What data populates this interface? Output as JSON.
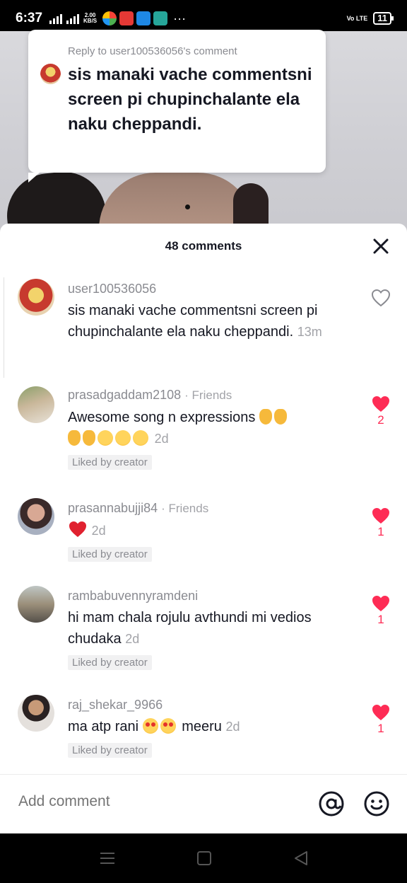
{
  "status_bar": {
    "time": "6:37",
    "net_speed_value": "2.00",
    "net_speed_unit": "KB/S",
    "carrier": "Vo LTE",
    "battery": "11"
  },
  "reply_sticker": {
    "header": "Reply to user100536056's comment",
    "text": "sis manaki vache commentsni screen pi chupinchalante ela naku cheppandi."
  },
  "comments_panel": {
    "count_label": "48 comments",
    "comments": [
      {
        "username": "user100536056",
        "friends": "",
        "text": "sis manaki vache commentsni screen pi chupinchalante ela naku cheppandi.",
        "time": "13m",
        "liked_by_creator": "",
        "likes": "",
        "liked": false
      },
      {
        "username": "prasadgaddam2108",
        "friends": "· Friends",
        "text": "Awesome song n expressions",
        "time": "2d",
        "liked_by_creator": "Liked by creator",
        "likes": "2",
        "liked": true
      },
      {
        "username": "prasannabujji84",
        "friends": "· Friends",
        "text": "",
        "time": "2d",
        "liked_by_creator": "Liked by creator",
        "likes": "1",
        "liked": true
      },
      {
        "username": "rambabuvennyramdeni",
        "friends": "",
        "text": "hi mam chala rojulu avthundi mi vedios chudaka",
        "time": "2d",
        "liked_by_creator": "Liked by creator",
        "likes": "1",
        "liked": true
      },
      {
        "username": "raj_shekar_9966",
        "friends": "",
        "text_before": "ma atp rani",
        "text_after": "meeru",
        "time": "2d",
        "liked_by_creator": "Liked by creator",
        "likes": "1",
        "liked": true
      }
    ]
  },
  "add_comment": {
    "placeholder": "Add comment"
  },
  "icons": {
    "close": "close-icon",
    "like": "heart-icon",
    "mention": "at-icon",
    "emoji": "smiley-icon"
  },
  "colors": {
    "like_red": "#fe2c55",
    "secondary_text": "#8a8b91"
  }
}
